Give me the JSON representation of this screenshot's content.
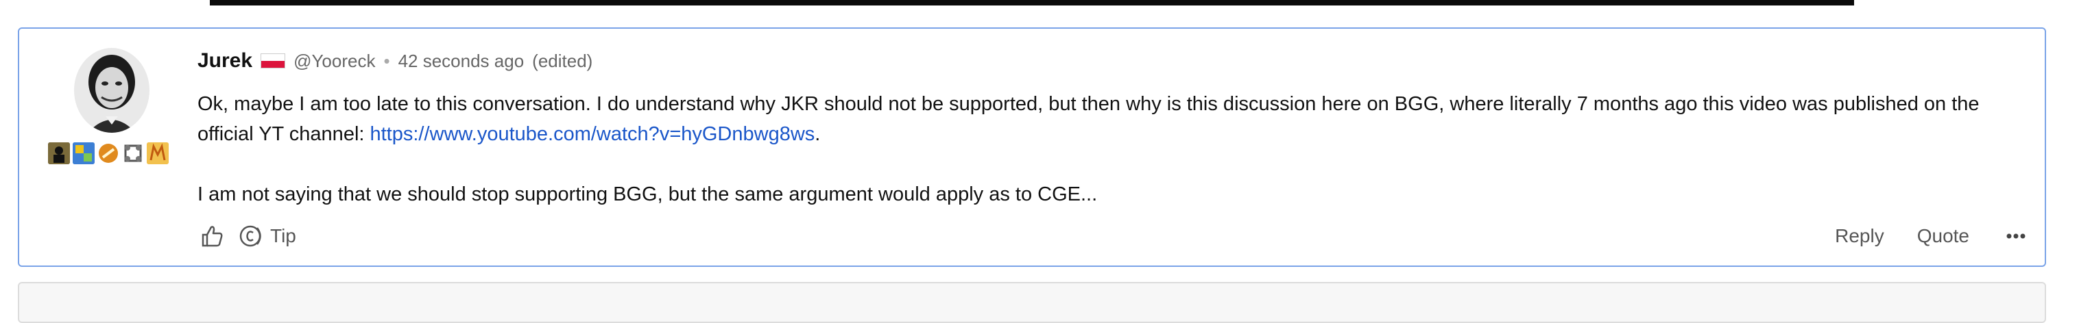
{
  "post": {
    "author": "Jurek",
    "handle": "@Yooreck",
    "timestamp": "42 seconds ago",
    "edited": "(edited)",
    "separator": "•",
    "body_line1_a": "Ok, maybe I am too late to this conversation. I do understand why JKR should not be supported, but then why is this discussion here on BGG, where literally 7 months ago this video was published on the official YT channel: ",
    "link": "https://www.youtube.com/watch?v=hyGDnbwg8ws",
    "body_line1_b": ".",
    "body_paragraph2": "I am not saying that we should stop supporting BGG, but the same argument would apply as to CGE..."
  },
  "actions": {
    "tip_label": "Tip",
    "reply_label": "Reply",
    "quote_label": "Quote"
  },
  "colors": {
    "link": "#1a56c9",
    "card_border": "#7aa3e8",
    "flag_white": "#ffffff",
    "flag_red": "#dc143c"
  },
  "icons": {
    "like": "thumbs-up-icon",
    "tip": "coin-tip-icon",
    "more": "more-dots-icon",
    "flag": "poland-flag-icon"
  }
}
